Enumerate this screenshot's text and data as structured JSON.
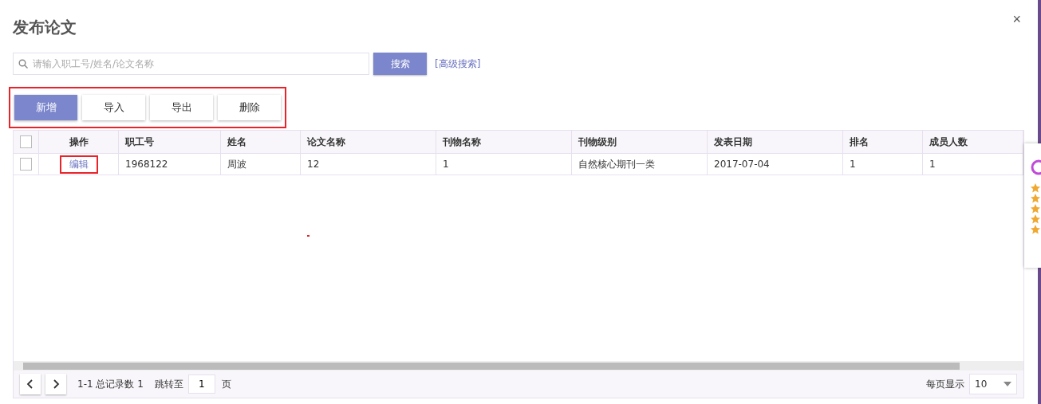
{
  "dialog": {
    "title": "发布论文",
    "close": "×"
  },
  "search": {
    "placeholder": "请输入职工号/姓名/论文名称",
    "button": "搜索",
    "advanced_link": "[高级搜索]"
  },
  "toolbar": {
    "highlighted": true,
    "buttons": [
      {
        "label": "新增",
        "primary": true
      },
      {
        "label": "导入",
        "primary": false
      },
      {
        "label": "导出",
        "primary": false
      },
      {
        "label": "删除",
        "primary": false
      }
    ]
  },
  "table": {
    "select_all_checked": false,
    "columns": [
      "操作",
      "职工号",
      "姓名",
      "论文名称",
      "刊物名称",
      "刊物级别",
      "发表日期",
      "排名",
      "成员人数"
    ],
    "rows": [
      {
        "checked": false,
        "action_highlighted": true,
        "cells": [
          "编辑",
          "1968122",
          "周波",
          "12",
          "1",
          "自然核心期刊一类",
          "2017-07-04",
          "1",
          "1"
        ]
      }
    ]
  },
  "pagination": {
    "range": "1-1 总记录数 1",
    "jump_label": "跳转至",
    "page": "1",
    "page_suffix": "页",
    "page_size_label": "每页显示",
    "page_size": "10"
  }
}
